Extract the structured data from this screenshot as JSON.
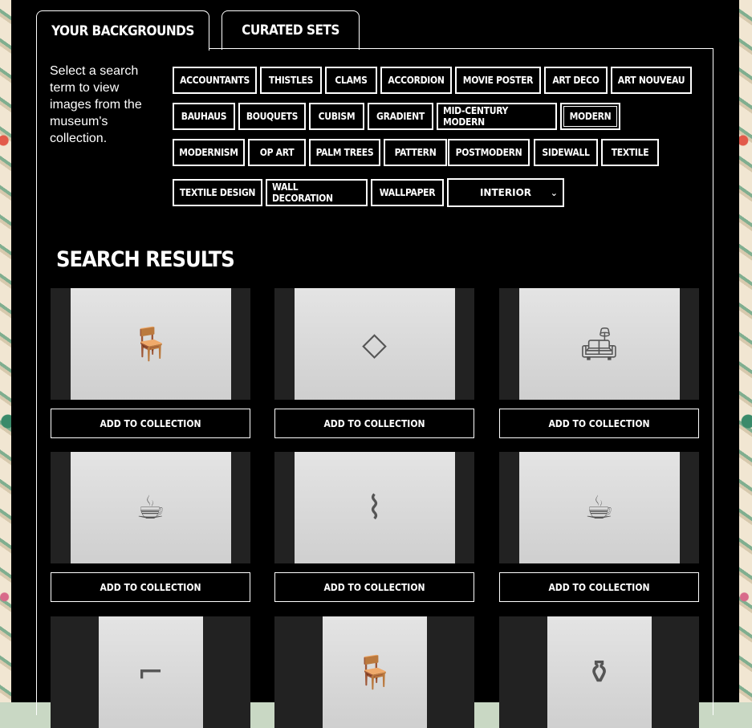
{
  "tabs": [
    {
      "label": "Your Backgrounds"
    },
    {
      "label": "Curated Sets"
    }
  ],
  "intro": "Select a search term to view images from the museum's collection.",
  "terms": [
    "Accountants",
    "Thistles",
    "Clams",
    "Accordion",
    "Movie Poster",
    "Art Deco",
    "Art Nouveau",
    "Bauhaus",
    "Bouquets",
    "Cubism",
    "Gradient",
    "Mid-Century Modern",
    "Modern",
    "Modernism",
    "Op Art",
    "Palm Trees",
    "Pattern",
    "Postmodern",
    "Sidewall",
    "Textile",
    "Textile Design",
    "Wall Decoration",
    "Wallpaper"
  ],
  "selected_term": "Modern",
  "select": {
    "value": "Interior"
  },
  "results_title": "Search Results",
  "add_label": "Add to Collection",
  "results": [
    {
      "icon": "chair-icon",
      "glyph": "🪑"
    },
    {
      "icon": "tray-icon",
      "glyph": "◇"
    },
    {
      "icon": "lamp-icon",
      "glyph": "🛋"
    },
    {
      "icon": "tea-set-icon",
      "glyph": "☕"
    },
    {
      "icon": "lounge-chair-icon",
      "glyph": "⌇"
    },
    {
      "icon": "tea-set-icon",
      "glyph": "☕"
    },
    {
      "icon": "floor-lamp-icon",
      "glyph": "⌐"
    },
    {
      "icon": "chair-icon",
      "glyph": "🪑"
    },
    {
      "icon": "pitcher-icon",
      "glyph": "⚱"
    }
  ]
}
